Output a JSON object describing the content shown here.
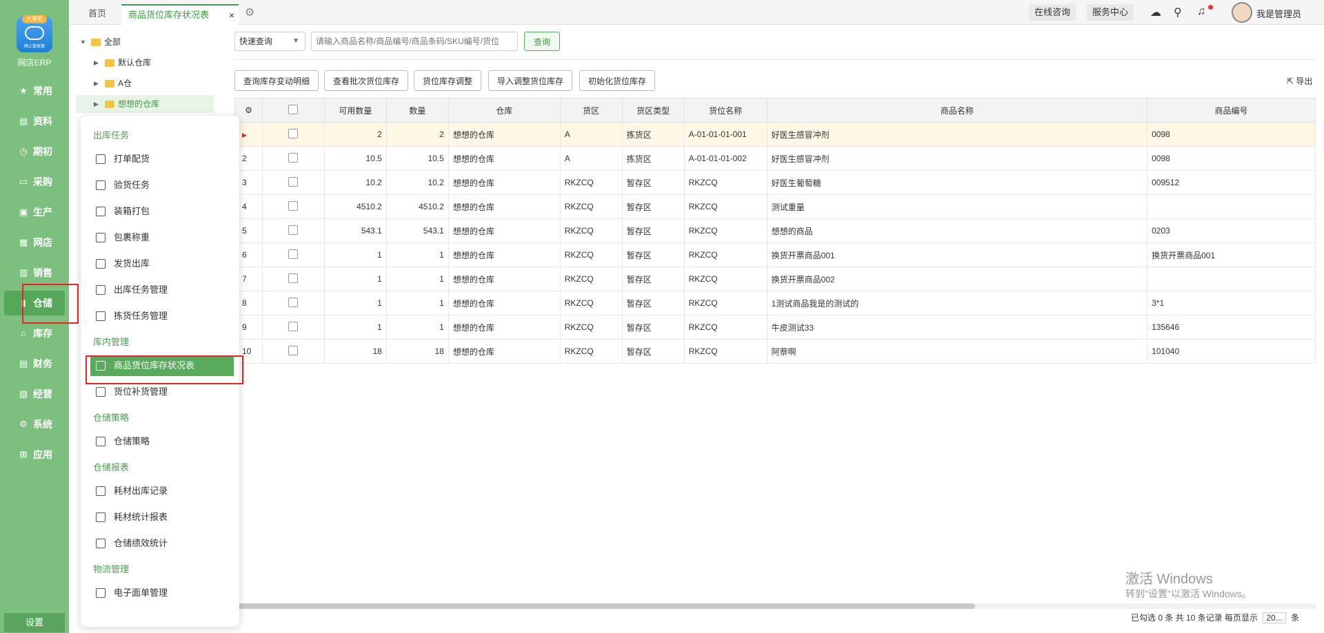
{
  "sidebar": {
    "logo_badge": "大掌柜",
    "logo_sub": "网上管家婆",
    "brand": "网店ERP",
    "items": [
      {
        "label": "常用",
        "icon": "star-icon",
        "glyph": "★"
      },
      {
        "label": "资料",
        "icon": "document-icon",
        "glyph": "▤"
      },
      {
        "label": "期初",
        "icon": "clock-icon",
        "glyph": "◷"
      },
      {
        "label": "采购",
        "icon": "cart-icon",
        "glyph": "▭"
      },
      {
        "label": "生产",
        "icon": "factory-icon",
        "glyph": "▣"
      },
      {
        "label": "网店",
        "icon": "store-icon",
        "glyph": "▦"
      },
      {
        "label": "销售",
        "icon": "chart-icon",
        "glyph": "▥"
      },
      {
        "label": "仓储",
        "icon": "warehouse-icon",
        "glyph": "▮"
      },
      {
        "label": "库存",
        "icon": "house-icon",
        "glyph": "⌂"
      },
      {
        "label": "财务",
        "icon": "finance-icon",
        "glyph": "▤"
      },
      {
        "label": "经营",
        "icon": "trend-icon",
        "glyph": "▧"
      },
      {
        "label": "系统",
        "icon": "gear-icon",
        "glyph": "⚙"
      },
      {
        "label": "应用",
        "icon": "plus-icon",
        "glyph": "⊞"
      }
    ],
    "settings": "设置"
  },
  "topbar": {
    "home_tab": "首页",
    "current_tab": "商品货位库存状况表",
    "close": "×",
    "consult": "在线咨询",
    "service": "服务中心",
    "user": "我是管理员"
  },
  "tree": {
    "root": "全部",
    "children": [
      "默认仓库",
      "A仓",
      "想想的仓库"
    ]
  },
  "menu": {
    "groups": [
      "出库任务",
      "库内管理",
      "仓储策略",
      "仓储报表",
      "物流管理"
    ],
    "outbound": [
      "打单配货",
      "验货任务",
      "装箱打包",
      "包裹称重",
      "发货出库",
      "出库任务管理",
      "拣货任务管理"
    ],
    "inwarehouse": [
      "商品货位库存状况表",
      "货位补货管理"
    ],
    "strategy": [
      "仓储策略"
    ],
    "reports": [
      "耗材出库记录",
      "耗材统计报表",
      "仓储绩效统计"
    ],
    "logistics": [
      "电子面单管理"
    ]
  },
  "search": {
    "mode": "快速查询",
    "placeholder": "请输入商品名称/商品编号/商品条码/SKU编号/货位",
    "button": "查询"
  },
  "actions": [
    "查询库存变动明细",
    "查看批次货位库存",
    "货位库存调整",
    "导入调整货位库存",
    "初始化货位库存"
  ],
  "export": "导出",
  "table": {
    "headers": [
      "可用数量",
      "数量",
      "仓库",
      "货区",
      "货区类型",
      "货位名称",
      "商品名称",
      "商品编号"
    ],
    "rows": [
      {
        "idx": "",
        "avail": "2",
        "qty": "2",
        "wh": "想想的仓库",
        "zone": "A",
        "ztype": "拣货区",
        "loc": "A-01-01-01-001",
        "name": "好医生感冒冲剂",
        "code": "0098"
      },
      {
        "idx": "2",
        "avail": "10.5",
        "qty": "10.5",
        "wh": "想想的仓库",
        "zone": "A",
        "ztype": "拣货区",
        "loc": "A-01-01-01-002",
        "name": "好医生感冒冲剂",
        "code": "0098"
      },
      {
        "idx": "3",
        "avail": "10.2",
        "qty": "10.2",
        "wh": "想想的仓库",
        "zone": "RKZCQ",
        "ztype": "暂存区",
        "loc": "RKZCQ",
        "name": "好医生葡萄糖",
        "code": "009512"
      },
      {
        "idx": "4",
        "avail": "4510.2",
        "qty": "4510.2",
        "wh": "想想的仓库",
        "zone": "RKZCQ",
        "ztype": "暂存区",
        "loc": "RKZCQ",
        "name": "测试重量",
        "code": ""
      },
      {
        "idx": "5",
        "avail": "543.1",
        "qty": "543.1",
        "wh": "想想的仓库",
        "zone": "RKZCQ",
        "ztype": "暂存区",
        "loc": "RKZCQ",
        "name": "想想的商品",
        "code": "0203"
      },
      {
        "idx": "6",
        "avail": "1",
        "qty": "1",
        "wh": "想想的仓库",
        "zone": "RKZCQ",
        "ztype": "暂存区",
        "loc": "RKZCQ",
        "name": "换货开票商品001",
        "code": "换货开票商品001"
      },
      {
        "idx": "7",
        "avail": "1",
        "qty": "1",
        "wh": "想想的仓库",
        "zone": "RKZCQ",
        "ztype": "暂存区",
        "loc": "RKZCQ",
        "name": "换货开票商品002",
        "code": ""
      },
      {
        "idx": "8",
        "avail": "1",
        "qty": "1",
        "wh": "想想的仓库",
        "zone": "RKZCQ",
        "ztype": "暂存区",
        "loc": "RKZCQ",
        "name": "1测试商品我是的测试的",
        "code": "3*1"
      },
      {
        "idx": "9",
        "avail": "1",
        "qty": "1",
        "wh": "想想的仓库",
        "zone": "RKZCQ",
        "ztype": "暂存区",
        "loc": "RKZCQ",
        "name": "牛皮测试33",
        "code": "135646"
      },
      {
        "idx": "10",
        "avail": "18",
        "qty": "18",
        "wh": "想想的仓库",
        "zone": "RKZCQ",
        "ztype": "暂存区",
        "loc": "RKZCQ",
        "name": "阿萘啊",
        "code": "101040"
      }
    ]
  },
  "footer": {
    "status_pre": "已勾选 0 条 共 10 条记录 每页显示",
    "page_size": "20...",
    "status_post": "条"
  },
  "watermark": {
    "line1": "激活 Windows",
    "line2": "转到\"设置\"以激活 Windows。"
  },
  "colors": {
    "sidebar": "#7cbf7e",
    "accent": "#3a9b47",
    "highlight": "#e22222"
  }
}
